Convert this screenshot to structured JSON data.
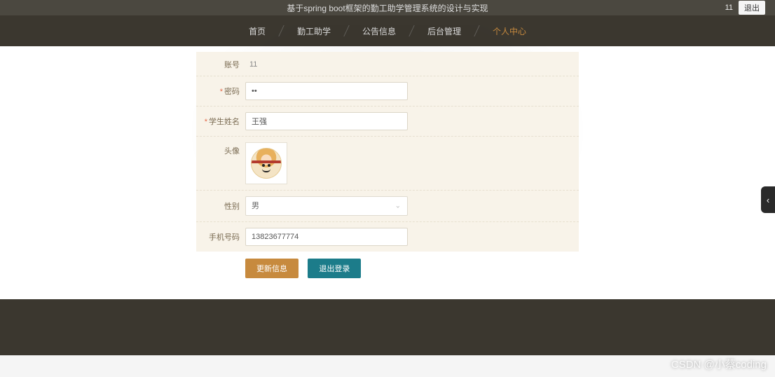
{
  "header": {
    "title": "基于spring boot框架的勤工助学管理系统的设计与实现",
    "user": "11",
    "logout": "退出"
  },
  "nav": {
    "items": [
      {
        "label": "首页",
        "active": false
      },
      {
        "label": "勤工助学",
        "active": false
      },
      {
        "label": "公告信息",
        "active": false
      },
      {
        "label": "后台管理",
        "active": false
      },
      {
        "label": "个人中心",
        "active": true
      }
    ]
  },
  "form": {
    "account": {
      "label": "账号",
      "value": "11"
    },
    "password": {
      "label": "密码",
      "value": "••"
    },
    "studentName": {
      "label": "学生姓名",
      "value": "王强"
    },
    "avatar": {
      "label": "头像"
    },
    "gender": {
      "label": "性别",
      "value": "男"
    },
    "phone": {
      "label": "手机号码",
      "value": "13823677774"
    }
  },
  "buttons": {
    "update": "更新信息",
    "logout": "退出登录"
  },
  "watermark": "CSDN @小蔡coding"
}
